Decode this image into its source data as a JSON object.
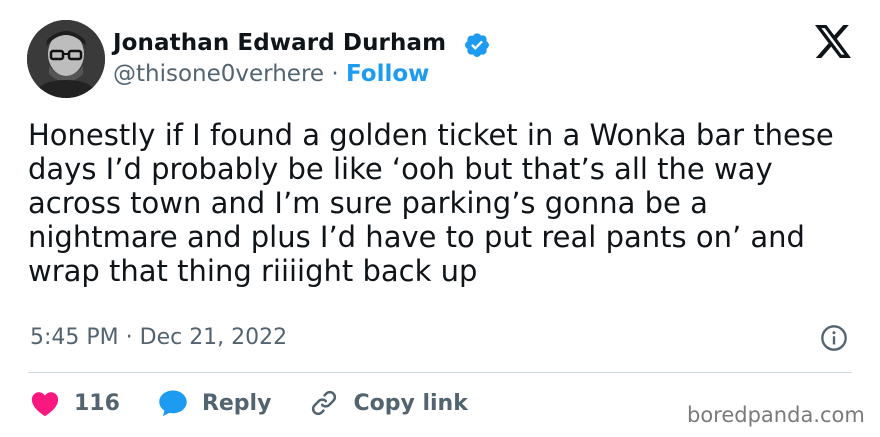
{
  "author": {
    "name": "Jonathan Edward Durham",
    "handle": "@thisone0verhere",
    "separator": "·",
    "follow_label": "Follow",
    "verified_icon": "verified-badge-icon"
  },
  "platform_logo": "x-logo-icon",
  "tweet": {
    "text": "Honestly if I found a golden ticket in a Wonka bar these days I’d probably be like ‘ooh but that’s all the way across town and I’m sure parking’s gonna be a nightmare and plus I’d have to put real pants on’ and wrap that thing riiiight back up",
    "timestamp": "5:45 PM · Dec 21, 2022"
  },
  "actions": {
    "like_count": "116",
    "reply_label": "Reply",
    "copy_label": "Copy link"
  },
  "watermark": "boredpanda.com",
  "colors": {
    "accent": "#1d9bf0",
    "heart": "#f91880",
    "text": "#0f1419",
    "muted": "#536471"
  }
}
